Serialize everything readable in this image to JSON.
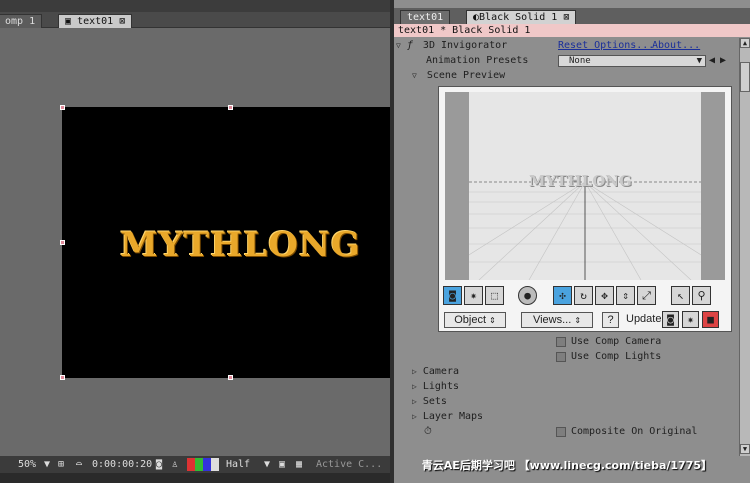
{
  "comp_panel": {
    "tabs": [
      "omp 1",
      "text01"
    ],
    "canvas_text": "MYTHLONG",
    "bottom_bar": {
      "zoom": "50%",
      "timecode": "0:00:00:20",
      "resolution": "Half",
      "view": "Active C..."
    }
  },
  "fx_panel": {
    "tabs": [
      "text01",
      "Black Solid 1"
    ],
    "header": "text01 * Black Solid 1",
    "effect_name": "3D Invigorator",
    "reset_options": "Reset Options...",
    "about": "About...",
    "animation_presets_label": "Animation Presets",
    "animation_presets_value": "None",
    "scene_preview_label": "Scene Preview",
    "preview_title": "MYTHLONG",
    "object_button": "Object",
    "views_button": "Views...",
    "help_button": "?",
    "update_label": "Update:",
    "use_comp_camera": "Use Comp Camera",
    "use_comp_lights": "Use Comp Lights",
    "sections": [
      "Camera",
      "Lights",
      "Sets",
      "Layer Maps"
    ],
    "composite_on_original": "Composite On Original"
  },
  "watermark": "青云AE后期学习吧 【www.linecg.com/tieba/1775】"
}
